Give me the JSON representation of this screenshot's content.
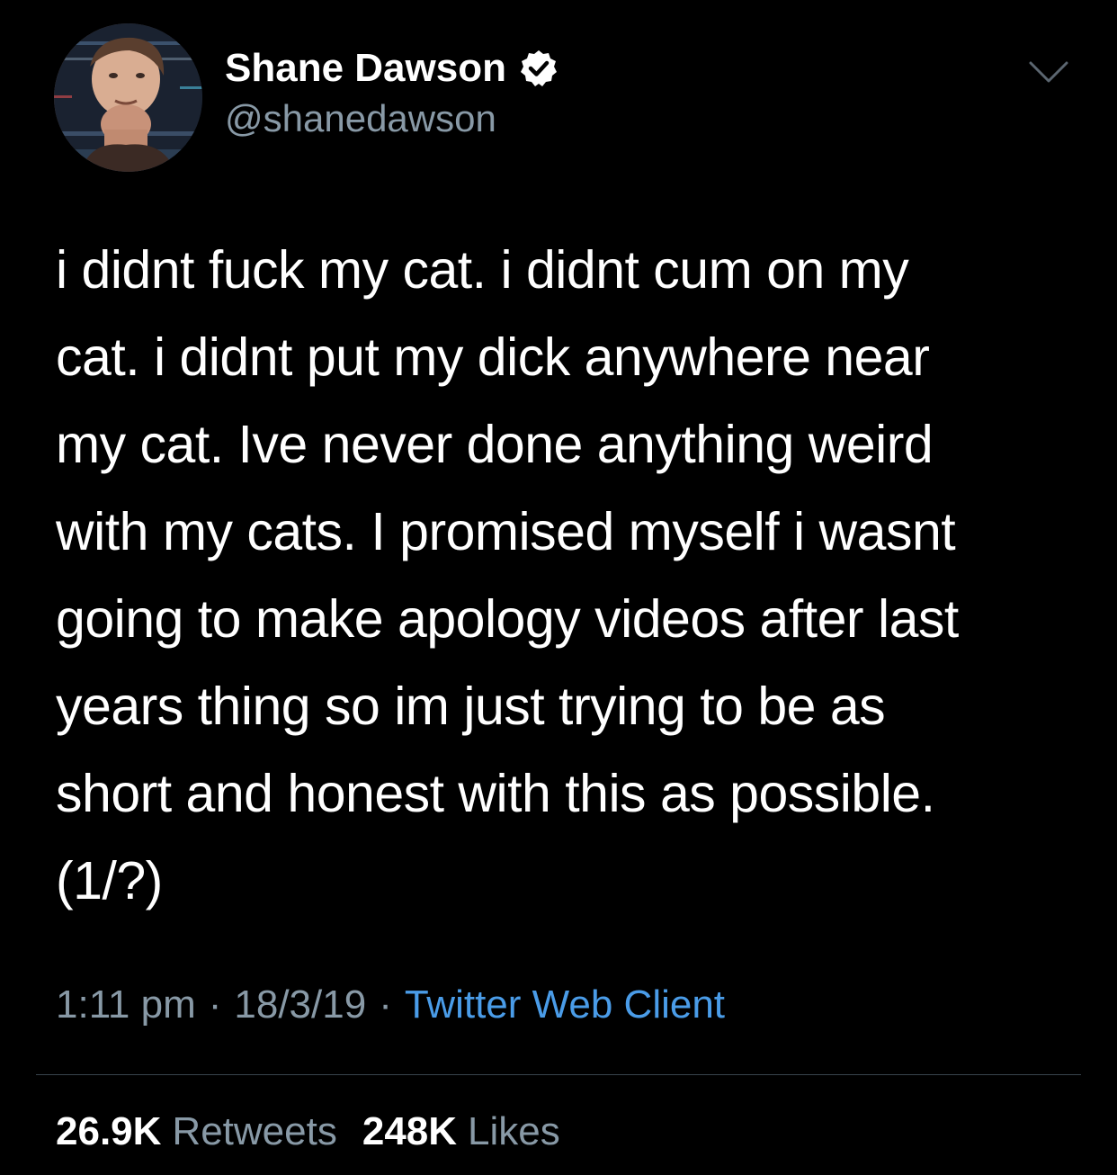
{
  "user": {
    "display_name": "Shane Dawson",
    "handle": "@shanedawson",
    "verified": true,
    "avatar_icon": "profile-photo"
  },
  "menu": {
    "icon": "chevron-down-icon"
  },
  "tweet": {
    "text": "i didnt fuck my cat. i didnt cum on my\ncat. i didnt put my dick anywhere near\nmy cat. Ive never done anything weird\nwith my cats. I promised myself i wasnt\ngoing to make apology videos after last\nyears thing so im just trying to be as\nshort and honest with this as possible.\n(1/?)",
    "time": "1:11 pm",
    "date": "18/3/19",
    "separator": "·",
    "client": "Twitter Web Client"
  },
  "stats": {
    "retweets_count": "26.9K",
    "retweets_label": "Retweets",
    "likes_count": "248K",
    "likes_label": "Likes"
  },
  "colors": {
    "background": "#000000",
    "primary_text": "#ffffff",
    "secondary_text": "#8899a6",
    "link": "#4a9ce8",
    "divider": "#38444d"
  }
}
